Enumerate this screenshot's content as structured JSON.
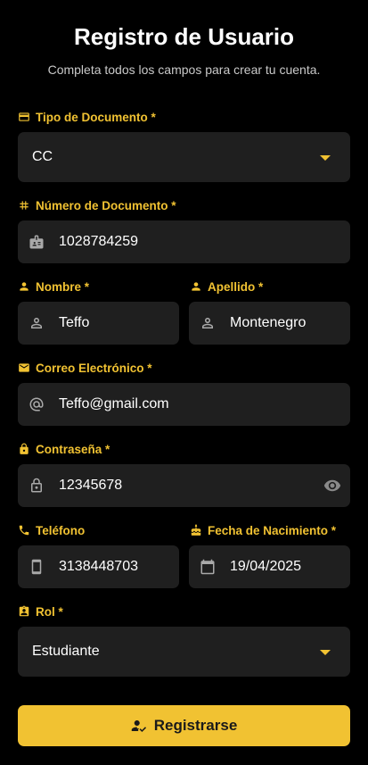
{
  "header": {
    "title": "Registro de Usuario",
    "subtitle": "Completa todos los campos para crear tu cuenta."
  },
  "theme": {
    "accent": "#f1c232",
    "field_bg": "#1f1f1f",
    "background": "#000000"
  },
  "form": {
    "document_type": {
      "label": "Tipo de Documento *",
      "value": "CC",
      "icon": "credit-card-icon"
    },
    "document_number": {
      "label": "Número de Documento *",
      "value": "1028784259",
      "icon": "badge-icon"
    },
    "first_name": {
      "label": "Nombre *",
      "value": "Teffo",
      "icon": "person-icon"
    },
    "last_name": {
      "label": "Apellido *",
      "value": "Montenegro",
      "icon": "person-icon"
    },
    "email": {
      "label": "Correo Electrónico *",
      "value": "Teffo@gmail.com",
      "icon": "at-icon"
    },
    "password": {
      "label": "Contraseña *",
      "value": "12345678",
      "icon": "lock-icon"
    },
    "phone": {
      "label": "Teléfono",
      "value": "3138448703",
      "icon": "phone-icon"
    },
    "birth_date": {
      "label": "Fecha de Nacimiento *",
      "value": "19/04/2025",
      "icon": "calendar-icon"
    },
    "role": {
      "label": "Rol *",
      "value": "Estudiante",
      "icon": "contact-icon"
    },
    "submit_label": "Registrarse"
  }
}
